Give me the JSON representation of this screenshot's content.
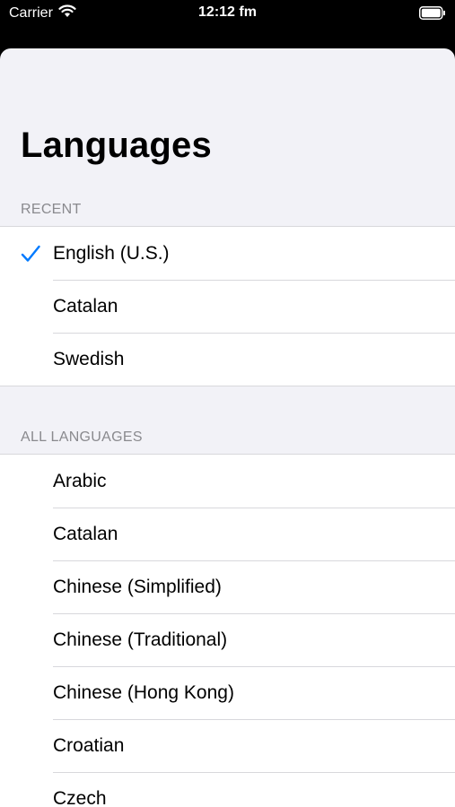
{
  "status_bar": {
    "carrier": "Carrier",
    "time": "12:12 fm"
  },
  "title": "Languages",
  "sections": {
    "recent": {
      "header": "RECENT",
      "items": [
        {
          "label": "English (U.S.)",
          "selected": true
        },
        {
          "label": "Catalan",
          "selected": false
        },
        {
          "label": "Swedish",
          "selected": false
        }
      ]
    },
    "all": {
      "header": "ALL LANGUAGES",
      "items": [
        {
          "label": "Arabic"
        },
        {
          "label": "Catalan"
        },
        {
          "label": "Chinese (Simplified)"
        },
        {
          "label": "Chinese (Traditional)"
        },
        {
          "label": "Chinese (Hong Kong)"
        },
        {
          "label": "Croatian"
        },
        {
          "label": "Czech"
        }
      ]
    }
  },
  "colors": {
    "accent": "#007aff",
    "background": "#f2f2f7",
    "separator": "#d8d8dc",
    "section_header": "#8a8a8e"
  }
}
